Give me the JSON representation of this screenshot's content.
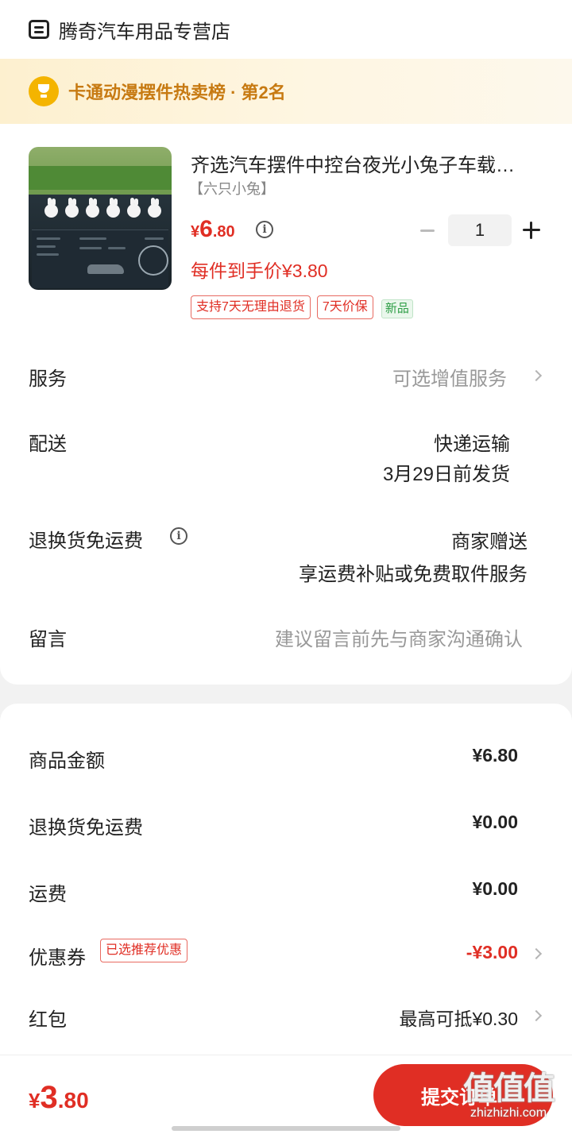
{
  "shop": {
    "name": "腾奇汽车用品专营店"
  },
  "ranking": {
    "text": "卡通动漫摆件热卖榜 · 第2名"
  },
  "product": {
    "title": "齐选汽车摆件中控台夜光小兔子车载…",
    "variant": "【六只小兔】",
    "price_symbol": "¥",
    "price_int": "6",
    "price_dec": ".80",
    "quantity": "1",
    "unit_price_text": "每件到手价¥3.80",
    "tags": [
      "支持7天无理由退货",
      "7天价保",
      "新品"
    ]
  },
  "rows": {
    "service": {
      "label": "服务",
      "value": "可选增值服务"
    },
    "delivery": {
      "label": "配送",
      "value": "快递运输",
      "sub": "3月29日前发货"
    },
    "return_insurance": {
      "label": "退换货免运费",
      "value": "商家赠送",
      "sub": "享运费补贴或免费取件服务"
    },
    "message": {
      "label": "留言",
      "placeholder": "建议留言前先与商家沟通确认"
    }
  },
  "summary": {
    "goods_amount": {
      "label": "商品金额",
      "value": "¥6.80"
    },
    "return_fee": {
      "label": "退换货免运费",
      "value": "¥0.00"
    },
    "shipping": {
      "label": "运费",
      "value": "¥0.00"
    },
    "coupon": {
      "label": "优惠券",
      "tag": "已选推荐优惠",
      "value": "-¥3.00"
    },
    "red_packet": {
      "label": "红包",
      "value": "最高可抵¥0.30"
    }
  },
  "footer": {
    "total_symbol": "¥",
    "total_int": "3",
    "total_dec": ".80",
    "submit_label": "提交订单",
    "watermark_big": "值值值",
    "watermark_small": "zhizhizhi.com"
  },
  "colors": {
    "accent": "#e02e24",
    "banner_text": "#c77a12",
    "trophy": "#f4b400"
  },
  "icons": [
    "shop-icon",
    "trophy-icon",
    "info-icon",
    "minus-icon",
    "plus-icon",
    "chevron-right-icon"
  ]
}
